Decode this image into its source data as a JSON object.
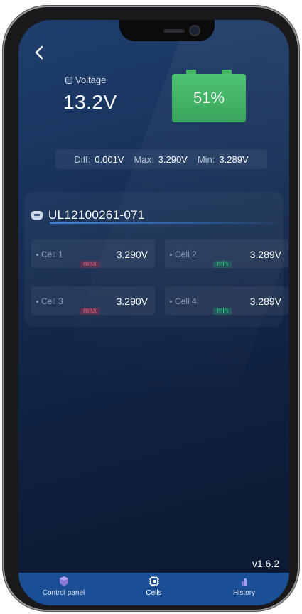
{
  "header": {
    "voltage_label": "Voltage",
    "voltage_value": "13.2V",
    "battery_percent": "51%",
    "battery_level": 51
  },
  "summary": {
    "diff_label": "Diff:",
    "diff_value": "0.001V",
    "max_label": "Max:",
    "max_value": "3.290V",
    "min_label": "Min:",
    "min_value": "3.289V"
  },
  "pack": {
    "name": "UL12100261-071"
  },
  "cells": [
    {
      "label": "Cell 1",
      "value": "3.290V",
      "tag": "max"
    },
    {
      "label": "Cell 2",
      "value": "3.289V",
      "tag": "min"
    },
    {
      "label": "Cell 3",
      "value": "3.290V",
      "tag": "max"
    },
    {
      "label": "Cell 4",
      "value": "3.289V",
      "tag": "min"
    }
  ],
  "version": "v1.6.2",
  "tabs": [
    {
      "label": "Control panel",
      "icon": "control-panel-icon"
    },
    {
      "label": "Cells",
      "icon": "cells-icon",
      "active": true
    },
    {
      "label": "History",
      "icon": "history-icon"
    }
  ],
  "colors": {
    "battery_green": "#43b862",
    "max_tag": "#e0607a",
    "min_tag": "#3ed08b",
    "tabbar": "#1b4f95"
  }
}
